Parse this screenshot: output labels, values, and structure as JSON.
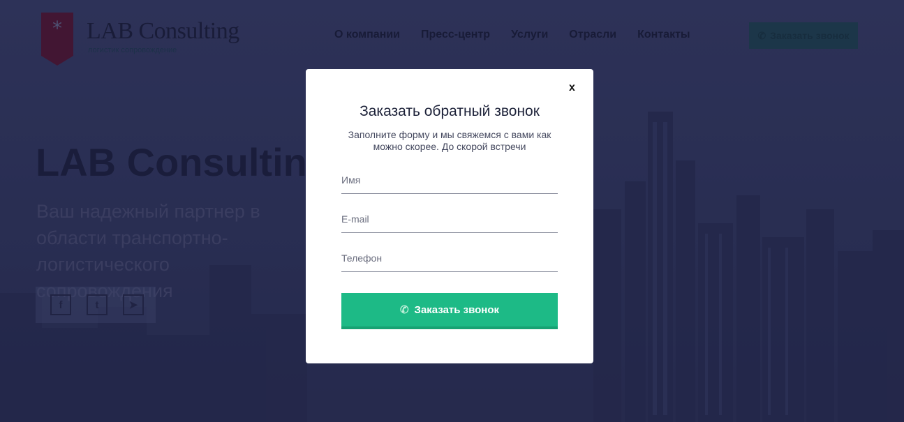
{
  "header": {
    "logo_title": "LAB Consulting",
    "logo_sub": "логистик сопровождение",
    "nav": [
      "О компании",
      "Пресс-центр",
      "Услуги",
      "Отрасли",
      "Контакты"
    ],
    "callback_button": "Заказать звонок"
  },
  "hero": {
    "title": "LAB Consulting",
    "subtitle": "Ваш надежный партнер в области транспортно-логистического сопровождения"
  },
  "social": [
    "facebook-icon",
    "twitter-icon",
    "telegram-icon"
  ],
  "modal": {
    "close_label": "x",
    "title": "Заказать обратный звонок",
    "text": "Заполните форму и мы свяжемся с вами как можно скорее. До скорой встречи",
    "name_placeholder": "Имя",
    "email_placeholder": "E-mail",
    "phone_placeholder": "Телефон",
    "submit_label": "Заказать звонок"
  },
  "colors": {
    "accent": "#1dba86",
    "background": "#2c3158",
    "logo": "#7a1b3a"
  }
}
